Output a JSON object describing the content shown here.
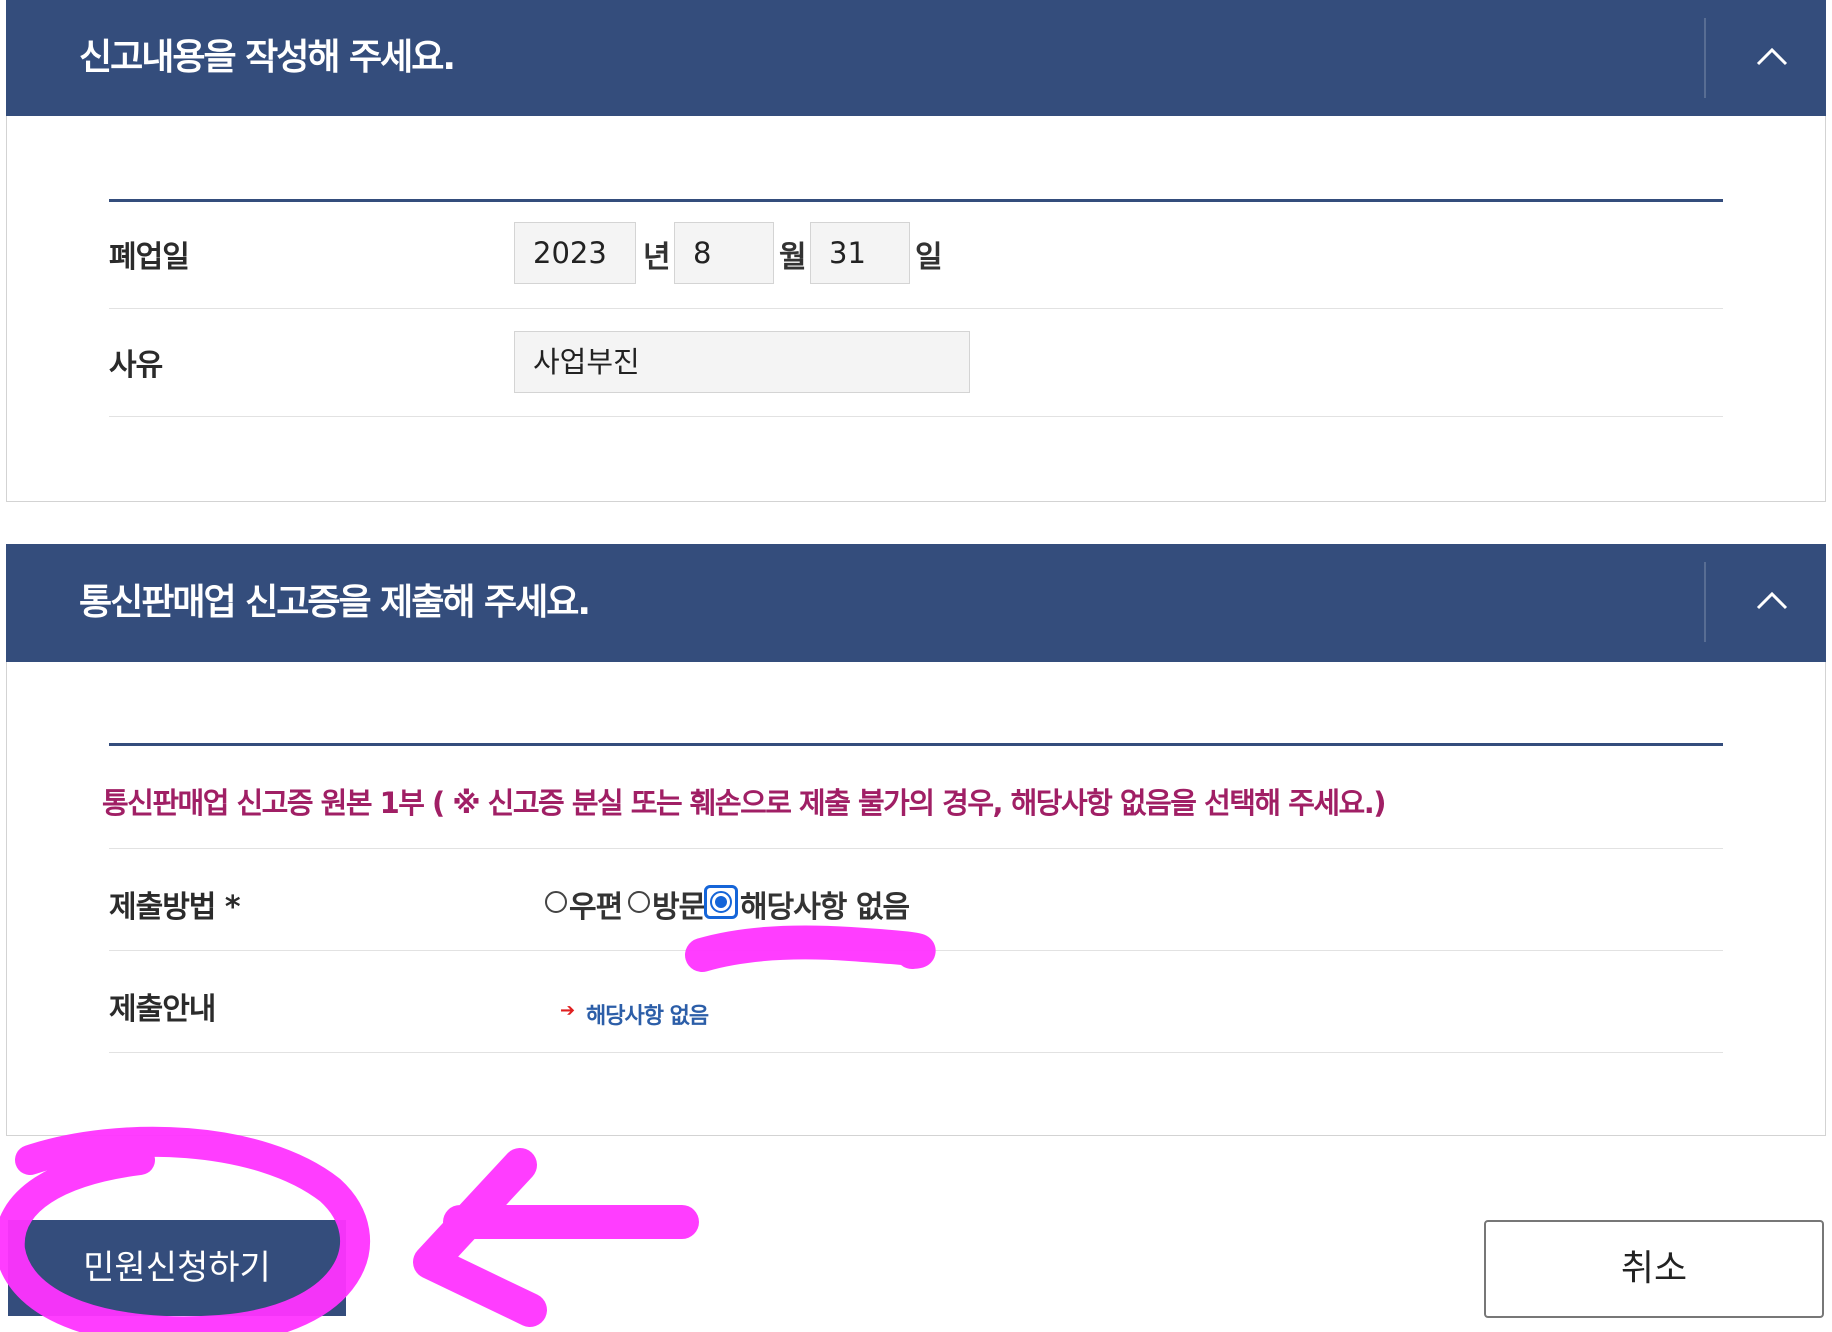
{
  "section1": {
    "title": "신고내용을 작성해 주세요.",
    "closure_date": {
      "label": "폐업일",
      "year": "2023",
      "year_unit": "년",
      "month": "8",
      "month_unit": "월",
      "day": "31",
      "day_unit": "일"
    },
    "reason": {
      "label": "사유",
      "value": "사업부진"
    }
  },
  "section2": {
    "title": "통신판매업 신고증을 제출해 주세요.",
    "notice": "통신판매업 신고증 원본 1부 ( ※ 신고증 분실 또는 훼손으로 제출 불가의 경우, 해당사항 없음을 선택해 주세요.)",
    "submit_method": {
      "label": "제출방법 *",
      "options": [
        {
          "label": "우편",
          "checked": false
        },
        {
          "label": "방문",
          "checked": false
        },
        {
          "label": "해당사항 없음",
          "checked": true
        }
      ]
    },
    "guide": {
      "label": "제출안내",
      "text": "해당사항 없음"
    }
  },
  "actions": {
    "submit": "민원신청하기",
    "cancel": "취소"
  },
  "colors": {
    "header": "#344d7c",
    "notice": "#a01f65",
    "radio_selected": "#1565d8",
    "annotation": "#ff33ff"
  }
}
